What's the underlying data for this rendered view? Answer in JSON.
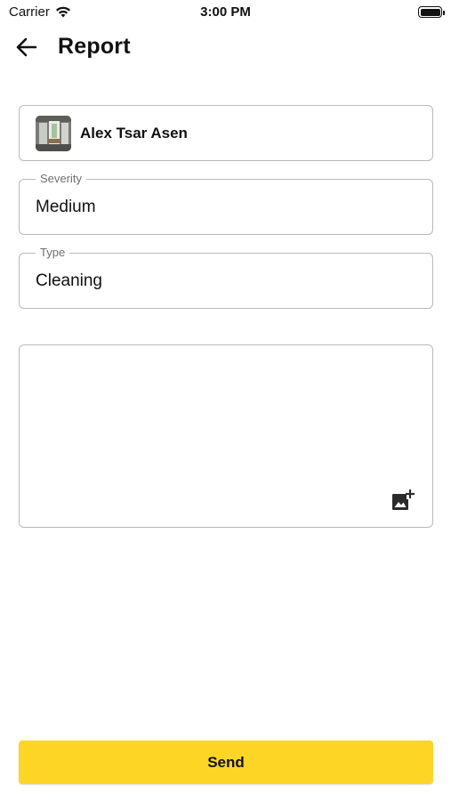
{
  "status_bar": {
    "carrier": "Carrier",
    "time": "3:00 PM",
    "wifi_icon": "wifi-icon",
    "battery_icon": "battery-icon"
  },
  "header": {
    "back_icon": "arrow-left-icon",
    "title": "Report"
  },
  "user": {
    "name": "Alex Tsar Asen",
    "avatar_icon": "room-photo-avatar"
  },
  "severity": {
    "label": "Severity",
    "value": "Medium"
  },
  "type": {
    "label": "Type",
    "value": "Cleaning"
  },
  "description": {
    "value": "",
    "add_image_icon": "add-photo-icon"
  },
  "send": {
    "label": "Send"
  },
  "colors": {
    "accent": "#fdd525",
    "border": "#b9b9b9",
    "label": "#6f6f6f"
  }
}
